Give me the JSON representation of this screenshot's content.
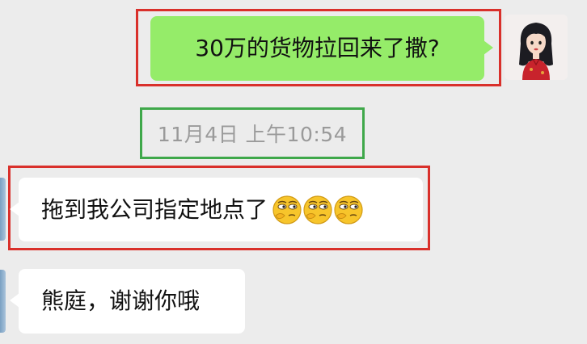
{
  "messages": {
    "outgoing_1": "30万的货物拉回来了撒?",
    "timestamp": "11月4日 上午10:54",
    "incoming_1": "拖到我公司指定地点了",
    "incoming_1_emojis": [
      "smirk-emoji",
      "smirk-emoji",
      "smirk-emoji"
    ],
    "incoming_2": "熊庭，谢谢你哦"
  },
  "colors": {
    "outgoing_bubble": "#95ec69",
    "incoming_bubble": "#ffffff",
    "background": "#ececec",
    "highlight_red": "#d9302b",
    "highlight_green": "#3fa84a",
    "timestamp_text": "#9a9a9a"
  },
  "icons": {
    "self_avatar": "avatar-girl-red-dress",
    "contact_avatar": "avatar-contact-blue"
  }
}
